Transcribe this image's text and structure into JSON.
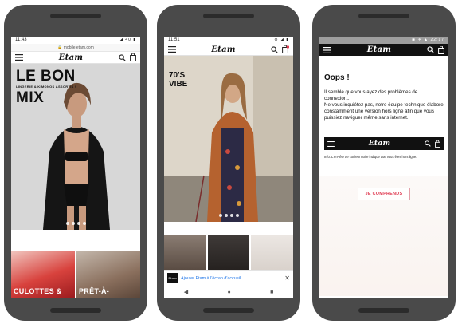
{
  "phone_left": {
    "status_time": "11:43",
    "status_icons": "◢ 40 ▮",
    "url": "mobile.etam.com",
    "logo": "Etam",
    "hero": {
      "line1": "LE BON",
      "subtitle": "LINGERIE & KIMONOS ASSORTIS !",
      "line2": "MIX",
      "dots_total": 4
    },
    "tiles": [
      {
        "label": "CULOTTES &"
      },
      {
        "label": "PRÊT-À-"
      }
    ]
  },
  "phone_middle": {
    "status_time": "11:51",
    "status_icons": "⊝ ◢ ▮",
    "logo": "Etam",
    "cart_badge": "0",
    "hero": {
      "line1": "70'S",
      "line2": "VIBE",
      "dots_total": 4
    },
    "add_to_home": "Ajouter Etam à l'écran d'accueil",
    "nav": {
      "back": "◀",
      "home": "●",
      "recents": "■"
    }
  },
  "phone_right": {
    "status_right": "◉ ✈ ▲ 22:17",
    "logo": "Etam",
    "title": "Oops !",
    "message": "Il semble que vous ayez des problèmes de connexion...\nNe vous inquiétez pas, notre équipe technique élabore constamment une version hors ligne afin que vous puissiez naviguer même sans internet.",
    "info": "Info: L'en-tête de couleur noire indique que vous êtes hors ligne.",
    "button": "JE COMPRENDS",
    "mini_logo": "Etam"
  },
  "colors": {
    "accent_pink": "#e03c52",
    "link_blue": "#1a73e8",
    "device_frame": "#4a4a4a",
    "offline_header": "#111111"
  }
}
